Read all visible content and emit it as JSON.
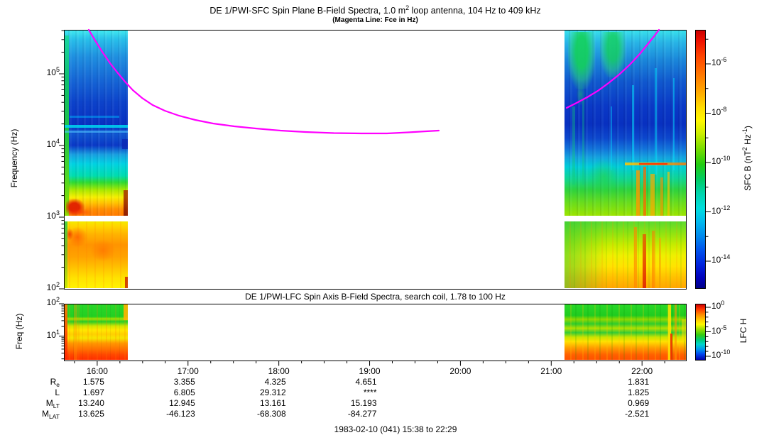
{
  "header": {
    "title_parts": [
      {
        "t": "DE 1/PWI-SFC  Spin Plane B-Field Spectra, 1.0 m"
      },
      {
        "sup": "2"
      },
      {
        "t": " loop antenna, 104 Hz to 409 kHz"
      }
    ],
    "subtitle": "(Magenta Line: Fce in Hz)"
  },
  "sfc": {
    "ylabel": "Frequency (Hz)",
    "log_base": "10",
    "yticks": [
      {
        "exp": "5",
        "y": 104
      },
      {
        "exp": "4",
        "y": 205
      },
      {
        "exp": "3",
        "y": 306
      },
      {
        "exp": "2",
        "y": 407
      }
    ],
    "colorbar": {
      "label_parts": [
        {
          "t": "SFC B (nT"
        },
        {
          "sup": "2"
        },
        {
          "t": " Hz"
        },
        {
          "sup": "-1"
        },
        {
          "t": ")"
        }
      ],
      "ticks": [
        {
          "exp": "-6",
          "y": 90
        },
        {
          "exp": "-8",
          "y": 159.5
        },
        {
          "exp": "-10",
          "y": 229
        },
        {
          "exp": "-12",
          "y": 298.5
        },
        {
          "exp": "-14",
          "y": 368
        }
      ]
    },
    "fce": {
      "color": "#ff00ff",
      "segments": [
        "125,42 134,57 144,73 155,89 166,103 176,115 187,127 200,138 215,148 232,156 252,163 275,169 300,174 330,178 360,181 395,184 430,186 470,187.5 510,188 545,188 575,186.5 600,185 618,184",
        "798,152 812,145 827,137 842,128 857,117 872,105 887,91 901,76 914,60 922,50 928,42"
      ]
    }
  },
  "lfc": {
    "title": "DE 1/PWI-LFC  Spin Axis B-Field Spectra, search coil, 1.78 to 100 Hz",
    "ylabel": "Freq (Hz)",
    "log_base": "10",
    "yticks": [
      {
        "exp": "2",
        "y": 428
      },
      {
        "exp": "1",
        "y": 474
      }
    ],
    "colorbar": {
      "label": "LFC H",
      "ticks": [
        {
          "exp": "0",
          "y": 433
        },
        {
          "exp": "-5",
          "y": 468
        },
        {
          "exp": "-10",
          "y": 502
        }
      ]
    }
  },
  "xaxis": {
    "start": "15:38",
    "end": "22:29",
    "hour_labels": [
      "16:00",
      "17:00",
      "18:00",
      "19:00",
      "20:00",
      "21:00",
      "22:00"
    ]
  },
  "ephemeris": {
    "rows": [
      {
        "label_parts": [
          {
            "t": "R"
          },
          {
            "sub": "e"
          }
        ],
        "values": [
          "1.575",
          "3.355",
          "4.325",
          "4.651",
          "",
          "",
          "1.831"
        ]
      },
      {
        "label_parts": [
          {
            "t": "L"
          }
        ],
        "values": [
          "1.697",
          "6.805",
          "29.312",
          "****",
          "",
          "",
          "1.825"
        ]
      },
      {
        "label_parts": [
          {
            "t": "M"
          },
          {
            "sub": "LT"
          }
        ],
        "values": [
          "13.240",
          "12.945",
          "13.161",
          "15.193",
          "",
          "",
          "0.969"
        ]
      },
      {
        "label_parts": [
          {
            "t": "M"
          },
          {
            "sub": "LAT"
          }
        ],
        "values": [
          "13.625",
          "-46.123",
          "-68.308",
          "-84.277",
          "",
          "",
          "-2.521"
        ]
      }
    ],
    "footer": "1983-02-10 (041) 15:38 to 22:29"
  },
  "chart_data": [
    {
      "type": "heatmap",
      "name": "sfc_spectrogram",
      "title": "DE 1/PWI-SFC  Spin Plane B-Field Spectra, 1.0 m² loop antenna, 104 Hz to 409 kHz",
      "subtitle": "(Magenta Line: Fce in Hz)",
      "ylabel": "Frequency (Hz)",
      "yscale": "log",
      "ylim_hz": [
        104,
        409000
      ],
      "ytick_labels": [
        "10^2",
        "10^3",
        "10^4",
        "10^5"
      ],
      "xlim_time": [
        "15:38",
        "22:29"
      ],
      "xtick_labels": [
        "16:00",
        "17:00",
        "18:00",
        "19:00",
        "20:00",
        "21:00",
        "22:00"
      ],
      "colorbar": {
        "label": "SFC B (nT^2 Hz^-1)",
        "tick_labels": [
          "10^-6",
          "10^-8",
          "10^-10",
          "10^-12",
          "10^-14"
        ],
        "palette": "rainbow red(high) to dark-blue(low)"
      },
      "data_intervals_time": [
        [
          "15:38",
          "16:20"
        ],
        [
          "21:09",
          "22:29"
        ]
      ],
      "notes": "White = no data between ~16:20 and ~21:09; thin white horizontal gap near 1 kHz; intense (red/orange) power below ~3 kHz, blue/cyan above ~10 kHz, green auroral-hiss patches near top of right block",
      "fce_line_time_hz": [
        [
          [
            "15:54",
            409000
          ],
          [
            "16:05",
            190000
          ],
          [
            "16:20",
            68000
          ],
          [
            "16:54",
            26000
          ],
          [
            "17:31",
            18500
          ],
          [
            "18:18",
            15400
          ],
          [
            "19:04",
            14700
          ],
          [
            "19:46",
            16100
          ]
        ],
        [
          [
            "21:10",
            33500
          ],
          [
            "21:38",
            74000
          ],
          [
            "21:58",
            188000
          ],
          [
            "22:11",
            409000
          ]
        ]
      ]
    },
    {
      "type": "heatmap",
      "name": "lfc_spectrogram",
      "title": "DE 1/PWI-LFC  Spin Axis B-Field Spectra, search coil, 1.78 to 100 Hz",
      "ylabel": "Freq (Hz)",
      "yscale": "log",
      "ylim_hz": [
        1.78,
        100
      ],
      "ytick_labels": [
        "10^1",
        "10^2"
      ],
      "colorbar": {
        "label": "LFC H",
        "tick_labels": [
          "10^0",
          "10^-5",
          "10^-10"
        ],
        "palette": "rainbow red(high) to blue(low)"
      },
      "data_intervals_time": [
        [
          "15:38",
          "16:20"
        ],
        [
          "21:09",
          "22:29"
        ]
      ],
      "notes": "Green at high frequencies grading to orange/red at lowest frequencies in both data blocks"
    },
    {
      "type": "table",
      "name": "ephemeris",
      "columns": [
        "16:00",
        "17:00",
        "18:00",
        "19:00",
        "20:00",
        "21:00",
        "22:00"
      ],
      "rows": [
        {
          "label": "Re",
          "values": [
            "1.575",
            "3.355",
            "4.325",
            "4.651",
            null,
            null,
            "1.831"
          ]
        },
        {
          "label": "L",
          "values": [
            "1.697",
            "6.805",
            "29.312",
            "****",
            null,
            null,
            "1.825"
          ]
        },
        {
          "label": "MLT",
          "values": [
            "13.240",
            "12.945",
            "13.161",
            "15.193",
            null,
            null,
            "0.969"
          ]
        },
        {
          "label": "MLAT",
          "values": [
            "13.625",
            "-46.123",
            "-68.308",
            "-84.277",
            null,
            null,
            "-2.521"
          ]
        }
      ],
      "footer": "1983-02-10 (041) 15:38 to 22:29"
    }
  ]
}
